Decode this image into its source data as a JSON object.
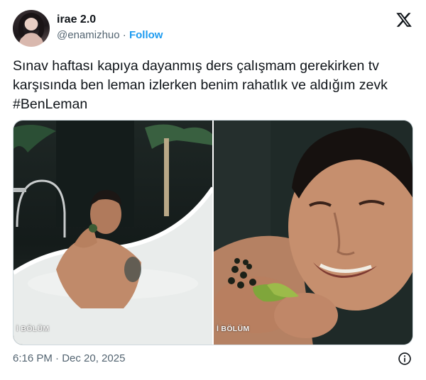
{
  "author": {
    "display_name": "irae 2.0",
    "handle": "@enamizhuo",
    "separator": "·",
    "follow_label": "Follow"
  },
  "tweet": {
    "text": "Sınav haftası kapıya dayanmış ders çalışmam gerekirken tv karşısında ben leman izlerken benim rahatlık ve aldığım zevk #BenLeman"
  },
  "media": {
    "photos": [
      {
        "caption": "İ BÖLÜM",
        "icon": "bathtub-scene"
      },
      {
        "caption": "İ BÖLÜM",
        "icon": "smiling-man-closeup"
      }
    ]
  },
  "footer": {
    "timestamp": "6:16 PM · Dec 20, 2025",
    "info_icon": "info-icon"
  },
  "brand": {
    "logo": "x-logo",
    "accent": "#1d9bf0",
    "text_primary": "#0f1419",
    "text_secondary": "#536471"
  }
}
